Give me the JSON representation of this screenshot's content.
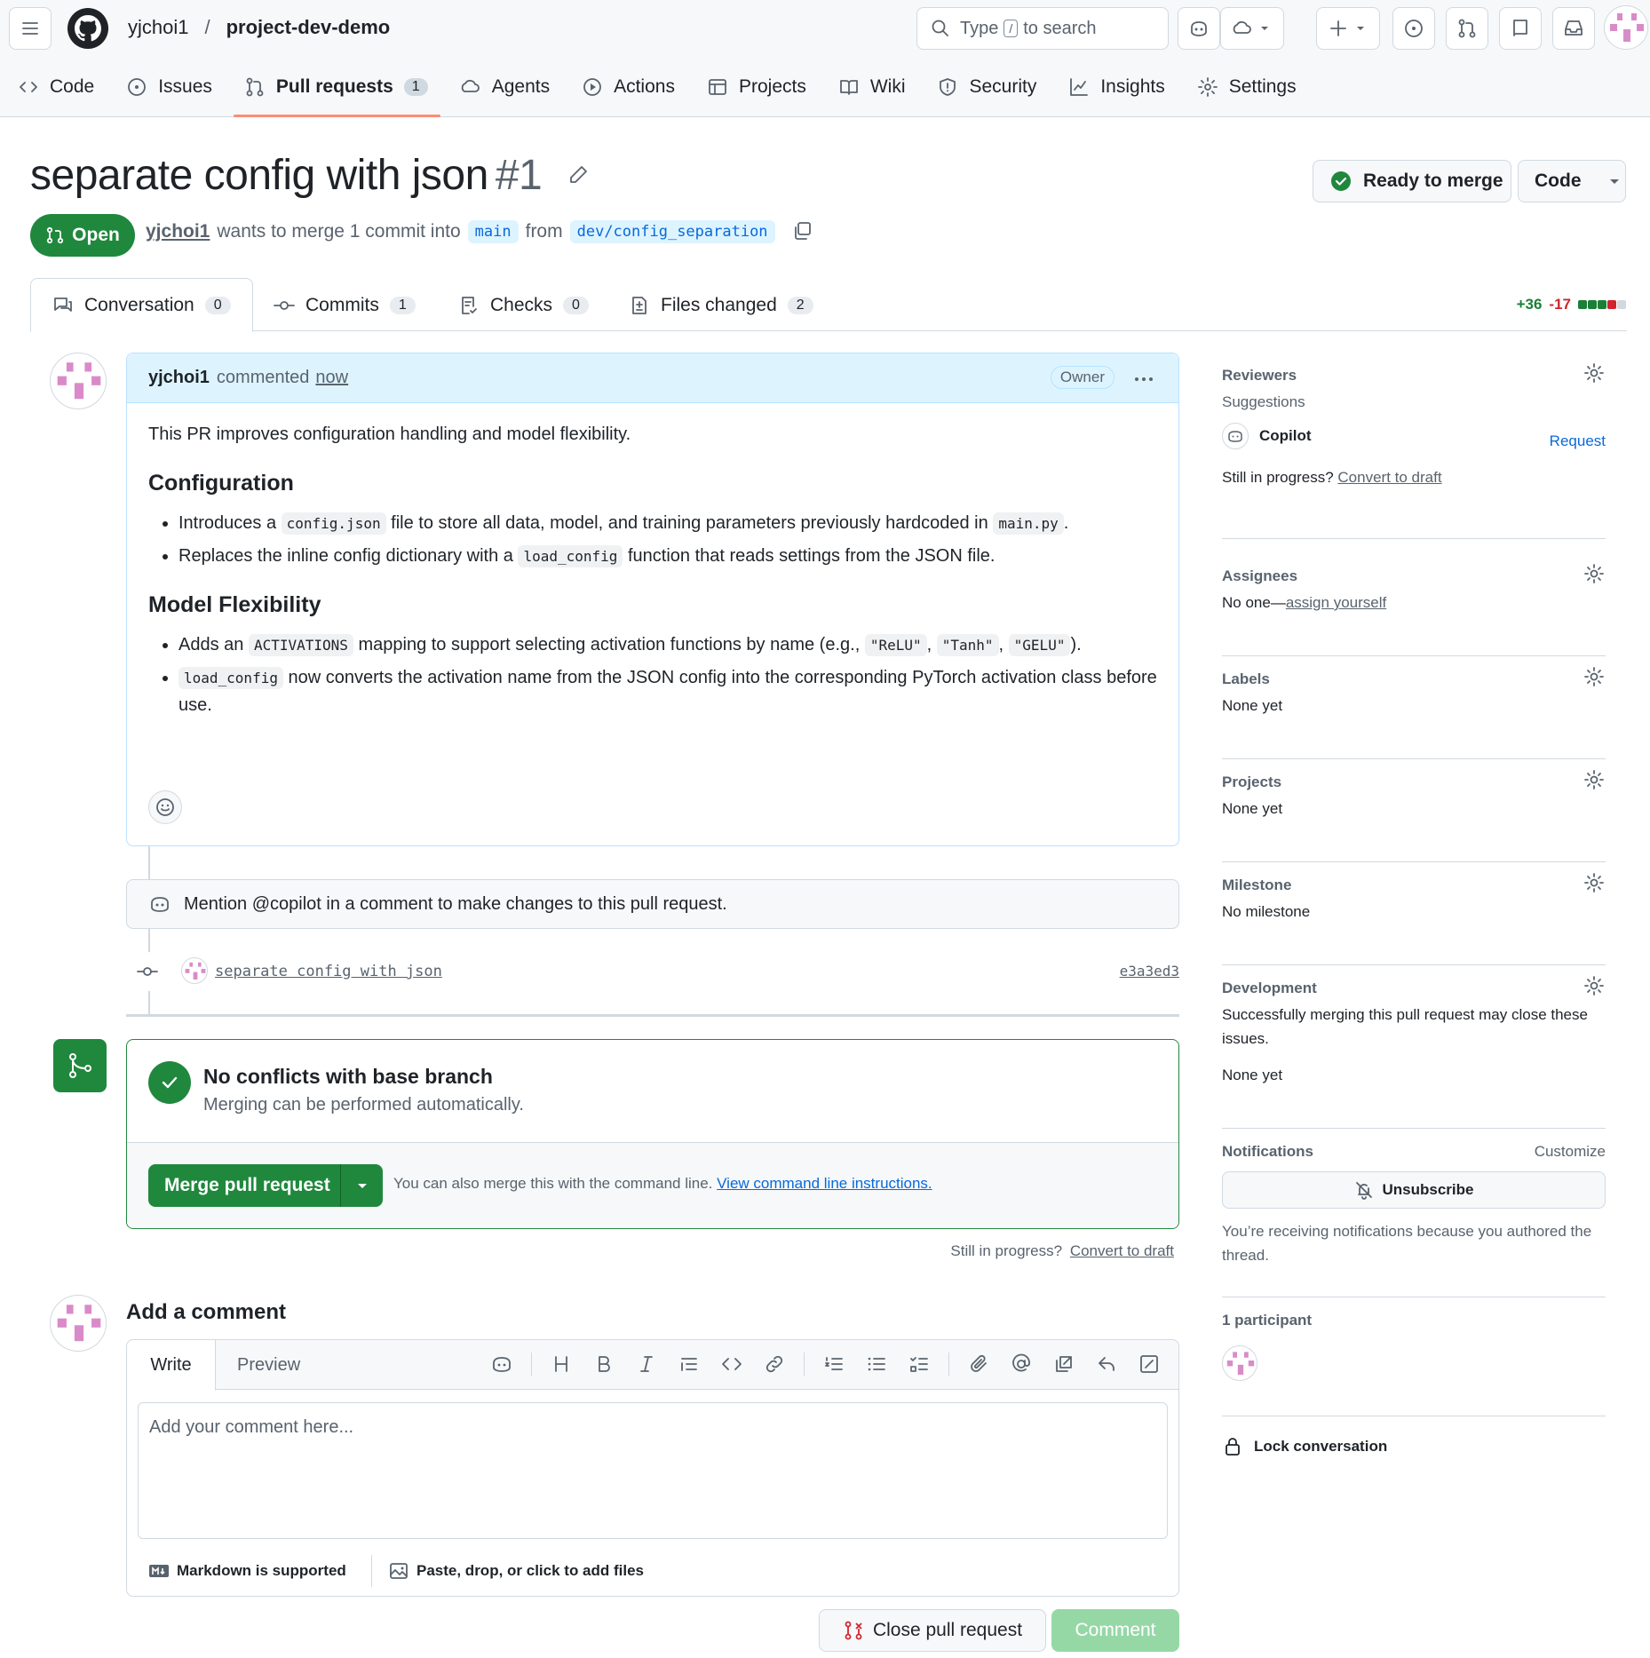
{
  "header": {
    "owner": "yjchoi1",
    "separator": "/",
    "repo": "project-dev-demo",
    "search": {
      "prefix": "Type",
      "key": "/",
      "suffix": "to search"
    }
  },
  "nav": [
    {
      "label": "Code",
      "icon": "code-icon"
    },
    {
      "label": "Issues",
      "icon": "issue-icon"
    },
    {
      "label": "Pull requests",
      "icon": "pull-request-icon",
      "count": "1",
      "active": true
    },
    {
      "label": "Agents",
      "icon": "agents-icon"
    },
    {
      "label": "Actions",
      "icon": "play-icon"
    },
    {
      "label": "Projects",
      "icon": "table-icon"
    },
    {
      "label": "Wiki",
      "icon": "book-icon"
    },
    {
      "label": "Security",
      "icon": "shield-icon"
    },
    {
      "label": "Insights",
      "icon": "graph-icon"
    },
    {
      "label": "Settings",
      "icon": "gear-icon"
    }
  ],
  "pr": {
    "title": "separate config with json",
    "number": "#1",
    "state": "Open",
    "author": "yjchoi1",
    "meta_text": "wants to merge 1 commit into",
    "base": "main",
    "from": "from",
    "head": "dev/config_separation",
    "ready_label": "Ready to merge",
    "code_label": "Code"
  },
  "tabs": [
    {
      "label": "Conversation",
      "count": "0"
    },
    {
      "label": "Commits",
      "count": "1"
    },
    {
      "label": "Checks",
      "count": "0"
    },
    {
      "label": "Files changed",
      "count": "2"
    }
  ],
  "diffstat": {
    "additions": "+36",
    "deletions": "-17"
  },
  "comment": {
    "author": "yjchoi1",
    "action": "commented",
    "time": "now",
    "badge": "Owner",
    "intro": "This PR improves configuration handling and model flexibility.",
    "h1": "Configuration",
    "c1_a": "Introduces a ",
    "c1_code1": "config.json",
    "c1_b": " file to store all data, model, and training parameters previously hardcoded in ",
    "c1_code2": "main.py",
    "c1_c": ".",
    "c2_a": "Replaces the inline config dictionary with a ",
    "c2_code": "load_config",
    "c2_b": " function that reads settings from the JSON file.",
    "h2": "Model Flexibility",
    "m1_a": "Adds an ",
    "m1_code": "ACTIVATIONS",
    "m1_b": " mapping to support selecting activation functions by name (e.g., ",
    "m1_c1": "\"ReLU\"",
    "m1_comma1": ", ",
    "m1_c2": "\"Tanh\"",
    "m1_comma2": ", ",
    "m1_c3": "\"GELU\"",
    "m1_end": ").",
    "m2_code": "load_config",
    "m2_text": " now converts the activation name from the JSON config into the corresponding PyTorch activation class before use."
  },
  "copilot_banner": "Mention @copilot in a comment to make changes to this pull request.",
  "commit": {
    "message": "separate config with json",
    "sha": "e3a3ed3"
  },
  "merge": {
    "title": "No conflicts with base branch",
    "subtitle": "Merging can be performed automatically.",
    "button": "Merge pull request",
    "hint": "You can also merge this with the command line.",
    "hint_link": "View command line instructions.",
    "still": "Still in progress?",
    "draft_link": "Convert to draft"
  },
  "add_comment": {
    "title": "Add a comment",
    "tab_write": "Write",
    "tab_preview": "Preview",
    "placeholder": "Add your comment here...",
    "markdown": "Markdown is supported",
    "files": "Paste, drop, or click to add files",
    "close_button": "Close pull request",
    "comment_button": "Comment"
  },
  "sidebar": {
    "reviewers": {
      "title": "Reviewers",
      "suggestions": "Suggestions",
      "suggested": "Copilot",
      "request": "Request",
      "still": "Still in progress?",
      "draft": "Convert to draft"
    },
    "assignees": {
      "title": "Assignees",
      "none": "No one—",
      "assign": "assign yourself"
    },
    "labels": {
      "title": "Labels",
      "value": "None yet"
    },
    "projects": {
      "title": "Projects",
      "value": "None yet"
    },
    "milestone": {
      "title": "Milestone",
      "value": "No milestone"
    },
    "development": {
      "title": "Development",
      "text": "Successfully merging this pull request may close these issues.",
      "value": "None yet"
    },
    "notifications": {
      "title": "Notifications",
      "customize": "Customize",
      "button": "Unsubscribe",
      "text": "You’re receiving notifications because you authored the thread."
    },
    "participants": {
      "title": "1 participant"
    },
    "lock": "Lock conversation"
  }
}
